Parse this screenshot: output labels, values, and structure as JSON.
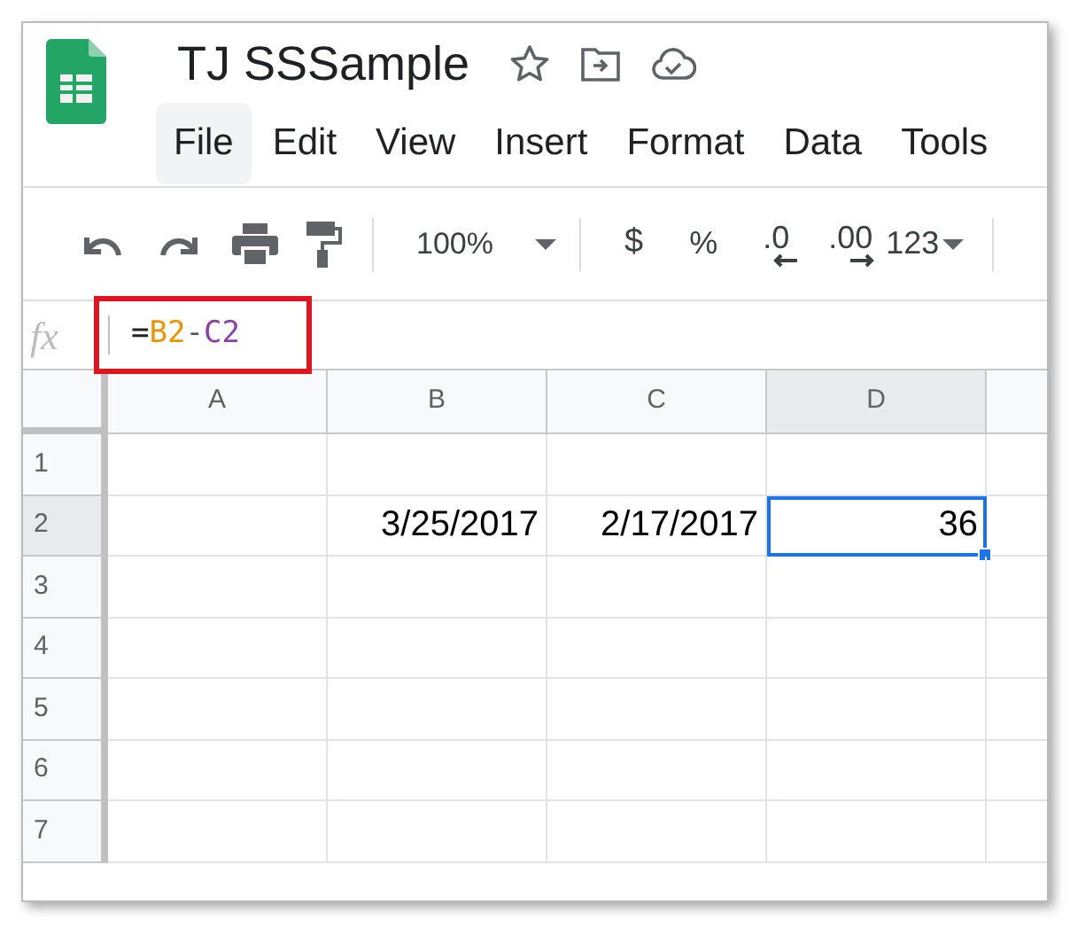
{
  "document": {
    "title": "TJ SSSample"
  },
  "menu": [
    {
      "label": "File",
      "selected": true
    },
    {
      "label": "Edit",
      "selected": false
    },
    {
      "label": "View",
      "selected": false
    },
    {
      "label": "Insert",
      "selected": false
    },
    {
      "label": "Format",
      "selected": false
    },
    {
      "label": "Data",
      "selected": false
    },
    {
      "label": "Tools",
      "selected": false
    }
  ],
  "toolbar": {
    "zoom": "100%",
    "currency": "$",
    "percent": "%",
    "decrease_decimals": ".0",
    "increase_decimals": ".00",
    "more_formats": "123"
  },
  "formula_bar": {
    "fx": "fx",
    "highlighted": true,
    "formula": [
      {
        "text": "=",
        "color": "#222222"
      },
      {
        "text": "B2",
        "color": "#f09300"
      },
      {
        "text": "-",
        "color": "#555555"
      },
      {
        "text": "C2",
        "color": "#8e3fa8"
      }
    ]
  },
  "sheet": {
    "columns": [
      {
        "label": "A",
        "selected": false
      },
      {
        "label": "B",
        "selected": false
      },
      {
        "label": "C",
        "selected": false
      },
      {
        "label": "D",
        "selected": true
      }
    ],
    "rows": [
      {
        "label": "1",
        "selected": false,
        "cells": [
          {
            "selected": false
          },
          {
            "selected": false
          },
          {
            "selected": false
          },
          {
            "selected": false
          }
        ]
      },
      {
        "label": "2",
        "selected": true,
        "cells": [
          {
            "selected": false
          },
          {
            "value": "3/25/2017",
            "selected": false
          },
          {
            "value": "2/17/2017",
            "selected": false
          },
          {
            "value": "36",
            "selected": true
          }
        ]
      },
      {
        "label": "3",
        "selected": false,
        "cells": [
          {
            "selected": false
          },
          {
            "selected": false
          },
          {
            "selected": false
          },
          {
            "selected": false
          }
        ]
      },
      {
        "label": "4",
        "selected": false,
        "cells": [
          {
            "selected": false
          },
          {
            "selected": false
          },
          {
            "selected": false
          },
          {
            "selected": false
          }
        ]
      },
      {
        "label": "5",
        "selected": false,
        "cells": [
          {
            "selected": false
          },
          {
            "selected": false
          },
          {
            "selected": false
          },
          {
            "selected": false
          }
        ]
      },
      {
        "label": "6",
        "selected": false,
        "cells": [
          {
            "selected": false
          },
          {
            "selected": false
          },
          {
            "selected": false
          },
          {
            "selected": false
          }
        ]
      },
      {
        "label": "7",
        "selected": false,
        "cells": [
          {
            "selected": false
          },
          {
            "selected": false
          },
          {
            "selected": false
          },
          {
            "selected": false
          }
        ]
      }
    ]
  }
}
